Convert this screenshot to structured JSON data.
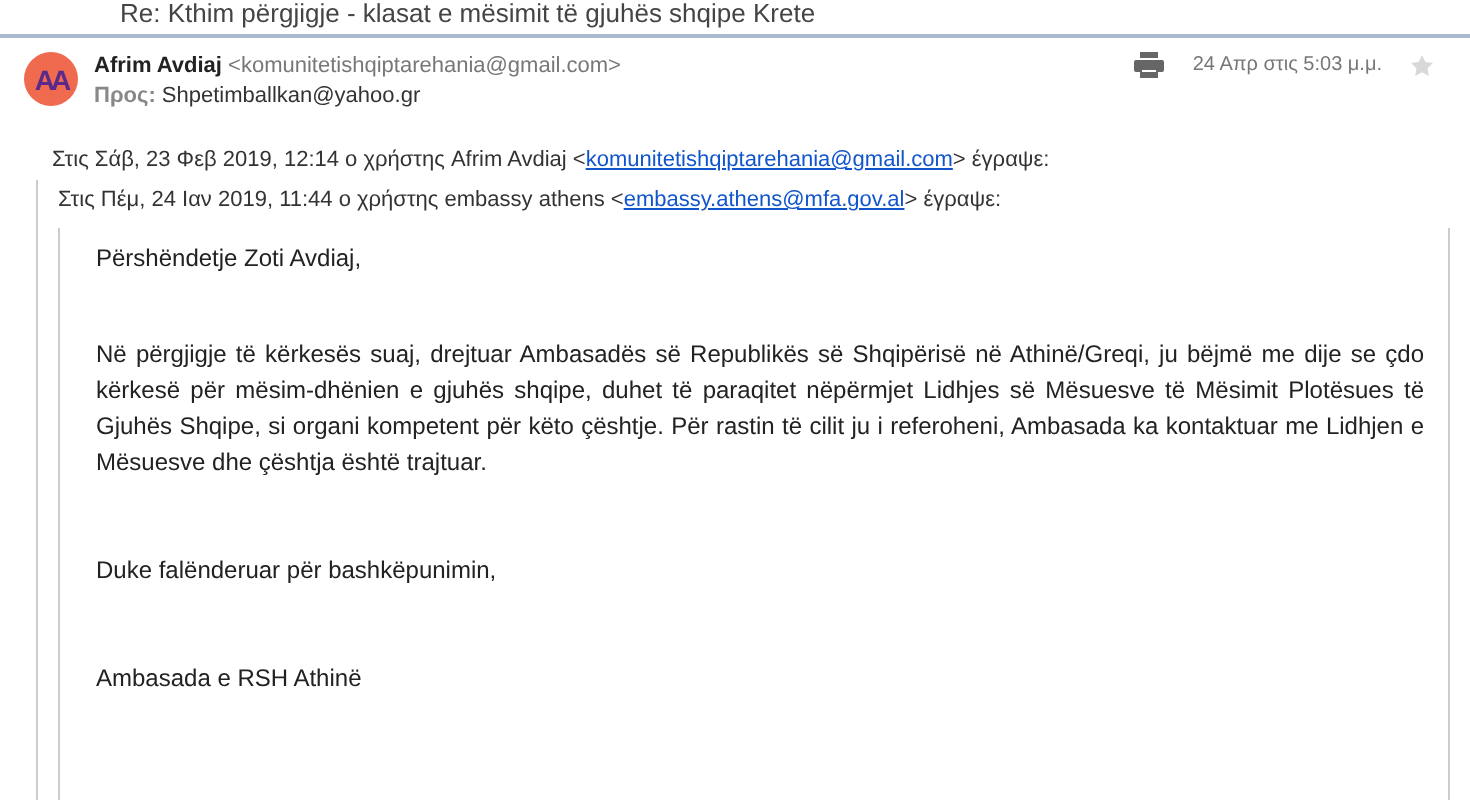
{
  "subject": "Re: Kthim përgjigje - klasat e mësimit të gjuhës shqipe Krete",
  "message": {
    "avatar_initials": "AA",
    "sender_name": "Afrim Avdiaj",
    "sender_email": "<komunitetishqiptarehania@gmail.com>",
    "to_label": "Προς:",
    "to": "Shpetimballkan@yahoo.gr",
    "date": "24 Απρ στις 5:03 μ.μ.",
    "starred": false
  },
  "quote_header": {
    "before": "Στις Σάβ, 23 Φεβ 2019, 12:14 ο χρήστης Afrim Avdiaj <",
    "link": "komunitetishqiptarehania@gmail.com",
    "after": "> έγραψε:"
  },
  "nested_quote_header": {
    "before": "Στις Πέμ, 24 Ιαν 2019, 11:44 ο χρήστης embassy athens <",
    "link": "embassy.athens@mfa.gov.al",
    "after": "> έγραψε:"
  },
  "body": [
    "Përshëndetje Zoti Avdiaj,",
    "Në përgjigje të kërkesës suaj, drejtuar Ambasadës së Republikës së Shqipërisë në Athinë/Greqi, ju bëjmë me dije se çdo kërkesë për mësim-dhënien e gjuhës shqipe, duhet të paraqitet nëpërmjet Lidhjes së Mësuesve të Mësimit Plotësues të Gjuhës Shqipe, si organi kompetent për këto çështje. Për rastin të cilit ju i referoheni, Ambasada ka kontaktuar me Lidhjen e Mësuesve dhe çështja është trajtuar.",
    "Duke falënderuar për bashkëpunimin,",
    "Ambasada e RSH Athinë"
  ]
}
